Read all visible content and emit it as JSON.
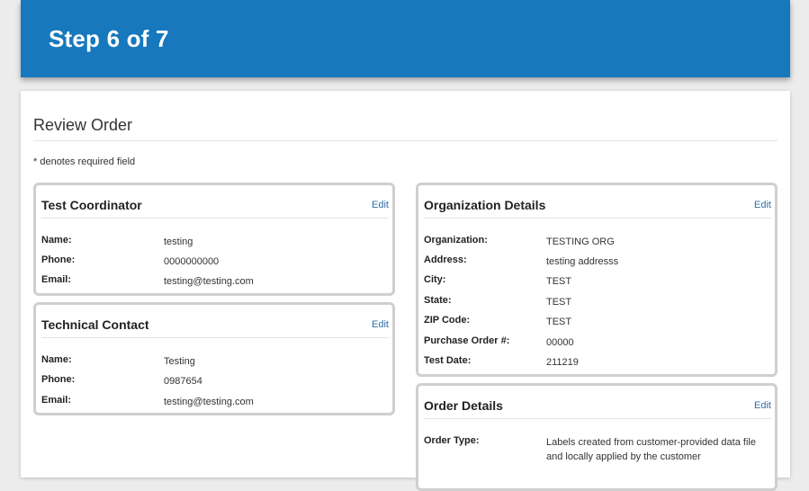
{
  "header": {
    "step_text": "Step 6 of 7"
  },
  "page": {
    "title": "Review Order",
    "required_note": "* denotes required field"
  },
  "test_coordinator": {
    "title": "Test Coordinator",
    "edit_label": "Edit",
    "rows": [
      {
        "label": "Name:",
        "value": "testing"
      },
      {
        "label": "Phone:",
        "value": "0000000000"
      },
      {
        "label": "Email:",
        "value": "testing@testing.com"
      }
    ]
  },
  "technical_contact": {
    "title": "Technical Contact",
    "edit_label": "Edit",
    "rows": [
      {
        "label": "Name:",
        "value": "Testing"
      },
      {
        "label": "Phone:",
        "value": "0987654"
      },
      {
        "label": "Email:",
        "value": "testing@testing.com"
      }
    ]
  },
  "organization_details": {
    "title": "Organization Details",
    "edit_label": "Edit",
    "rows": [
      {
        "label": "Organization:",
        "value": "TESTING ORG"
      },
      {
        "label": "Address:",
        "value": "testing addresss"
      },
      {
        "label": "City:",
        "value": "TEST"
      },
      {
        "label": "State:",
        "value": "TEST"
      },
      {
        "label": "ZIP Code:",
        "value": "TEST"
      },
      {
        "label": "Purchase Order #:",
        "value": "00000"
      },
      {
        "label": "Test Date:",
        "value": "211219"
      }
    ]
  },
  "order_details": {
    "title": "Order Details",
    "edit_label": "Edit",
    "rows": [
      {
        "label": "Order Type:",
        "value": "Labels created from customer-provided data file and locally applied by the customer"
      }
    ]
  }
}
